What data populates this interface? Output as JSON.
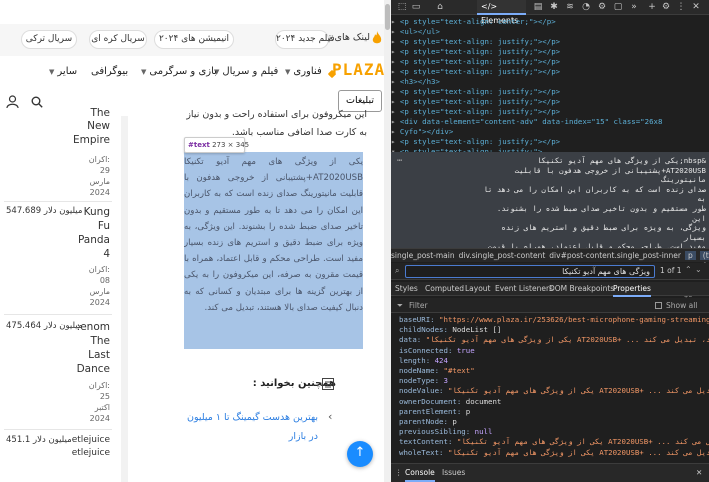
{
  "site": {
    "trend_label": "لینک های ترند",
    "trend_pills": [
      "فیلم جدید ۲۰۲۴",
      "انیمیشن های ۲۰۲۴",
      "سریال کره ای",
      "سریال ترکی"
    ],
    "logo": "PLAZA",
    "nav": [
      "فناوری",
      "فیلم و سریال",
      "بازی و سرگرمی",
      "بیوگرافی",
      "سایر"
    ],
    "ads_button": "تبلیغات",
    "icons": {
      "search": "search-icon",
      "user": "user-icon",
      "fire": "fire-icon",
      "list": "list-icon",
      "scroll_up": "arrow-up-icon"
    },
    "accent_color": "#f7a100",
    "link_color": "#2a7de1"
  },
  "sidebar": {
    "entries": [
      {
        "title_lines": [
          "The",
          "New",
          "Empire"
        ],
        "meta": [
          "اکران:",
          "29",
          "مارس",
          "2024"
        ],
        "sales": ""
      },
      {
        "title_lines": [
          "Kung",
          "Fu",
          "Panda",
          "4"
        ],
        "meta": [
          "اکران:",
          "08",
          "مارس",
          "2024"
        ],
        "sales": "547.689 میلیون دلار"
      },
      {
        "title_lines": [
          "enom:",
          "The",
          "Last",
          "Dance"
        ],
        "meta": [
          "اکران:",
          "25",
          "اکتبر",
          "2024"
        ],
        "sales": "475.464 میلیون دلار"
      },
      {
        "title_lines": [
          "etlejuice",
          "etlejuice"
        ],
        "meta": [],
        "sales": "451.1 میلیون دلار"
      }
    ]
  },
  "article": {
    "top_text": "این میکروفون برای استفاده راحت و بدون نیاز به کارت صدا اضافی مناسب باشد.",
    "highlighted_text": "یکی از ویژگی های مهم آدیو تکنیکا AT2020USB+پشتیبانی از خروجی هدفون با قابلیت مانیتورینگ صدای زنده است که به کاربران این امکان را می دهد تا به طور مستقیم و بدون تاخیر صدای ضبط شده را بشنوند. این ویژگی، به ویژه برای ضبط دقیق و استریم های زنده بسیار مفید است. طراحی محکم و قابل اعتماد، همراه با قیمت مقرون به صرفه، این میکروفون را به یکی از بهترین گزینه ها برای مبتدیان و کسانی که به دنبال کیفیت صدای بالا هستند، تبدیل می کند.",
    "tooltip_node": "#text",
    "tooltip_dims": "273 × 345",
    "related_heading": "همچنین بخوانید :",
    "related_link": "بهترین هدست گیمینگ تا ۱ میلیون در بازار",
    "fab_icon": "↑"
  },
  "devtools": {
    "tab_label": "Elements",
    "dom_lines": [
      "<p style=\"text-align: center;\"></p>",
      "<ul></ul>",
      "<p style=\"text-align: justify;\"></p>",
      "<p style=\"text-align: justify;\"></p>",
      "<p style=\"text-align: justify;\"></p>",
      "<p style=\"text-align: justify;\"></p>",
      "<h3></h3>",
      "<p style=\"text-align: justify;\"></p>",
      "<p style=\"text-align: justify;\"></p>",
      "<p style=\"text-align: justify;\"></p>",
      "<div data-element=\"content-adv\" data-index=\"15\" class=\"26x8",
      "Cyfo\"></div>",
      "<p style=\"text-align: justify;\"></p>",
      "<p style=\"text-align: justify;\">"
    ],
    "selected_text_lines": [
      "&nbsp;یکی از ویژگی های مهم آدیو تکنیکا",
      "AT2020USB+پشتیبانی از خروجی هدفون با قابلیت مانیتورینگ",
      "صدای زنده است که به کاربران این امکان را می دهد تا به",
      "طور مستقیم و بدون تاخیر صدای ضبط شده را بشنوند. این",
      "ویژگی، به ویژه برای ضبط دقیق و استریم های زنده بسیار",
      "مفید است. طراحی محکم و قابل اعتماد، همراه با قیمت",
      "مقرون به صرفه، این میکروفون را به یکی از بهترین گزینه",
      "ها برای مبتدیان و کسانی که به دنبال کیفیت صدای بالا",
      "هستند، تبدیل می کند."
    ],
    "selected_marker": "== $0",
    "breadcrumbs": [
      "single_post-main",
      "div.single_post-content",
      "div#post-content.single_post-inner",
      "p",
      "(text)"
    ],
    "find_query": "ویژگی های مهم آدیو تکنیکا",
    "find_count": "1 of 1",
    "subtabs": [
      "Styles",
      "Computed",
      "Layout",
      "Event Listeners",
      "DOM Breakpoints",
      "Properties"
    ],
    "active_subtab": "Properties",
    "filter_placeholder": "Filter",
    "show_all_label": "Show all",
    "properties": [
      {
        "k": "baseURI",
        "v": "\"https://www.plaza.ir/253626/best-microphone-gaming-streaming-buying-guide",
        "t": "str"
      },
      {
        "k": "childNodes",
        "v": "NodeList []",
        "t": "obj"
      },
      {
        "k": "data",
        "v": "\"یکی از ویژگی های مهم آدیو تکنیکا AT2020USB+ ... بالا هستند، تبدیل می کند.\"",
        "t": "str"
      },
      {
        "k": "isConnected",
        "v": "true",
        "t": "bool"
      },
      {
        "k": "length",
        "v": "424",
        "t": "num"
      },
      {
        "k": "nodeName",
        "v": "\"#text\"",
        "t": "str"
      },
      {
        "k": "nodeType",
        "v": "3",
        "t": "num"
      },
      {
        "k": "nodeValue",
        "v": "\"یکی از ویژگی های مهم آدیو تکنیکا AT2020USB+ ... تبدیل می کند.\"",
        "t": "str"
      },
      {
        "k": "ownerDocument",
        "v": "document",
        "t": "obj"
      },
      {
        "k": "parentElement",
        "v": "p",
        "t": "obj"
      },
      {
        "k": "parentNode",
        "v": "p",
        "t": "obj"
      },
      {
        "k": "previousSibling",
        "v": "null",
        "t": "bool"
      },
      {
        "k": "textContent",
        "v": "\"یکی از ویژگی های مهم آدیو تکنیکا AT2020USB+ ... تبدیل می کند.\"",
        "t": "str"
      },
      {
        "k": "wholeText",
        "v": "\"یکی از ویژگی های مهم آدیو تکنیکا AT2020USB+ ... تبدیل می کند.\"",
        "t": "str"
      }
    ],
    "console_tab": "Console",
    "issues_tab": "Issues"
  }
}
